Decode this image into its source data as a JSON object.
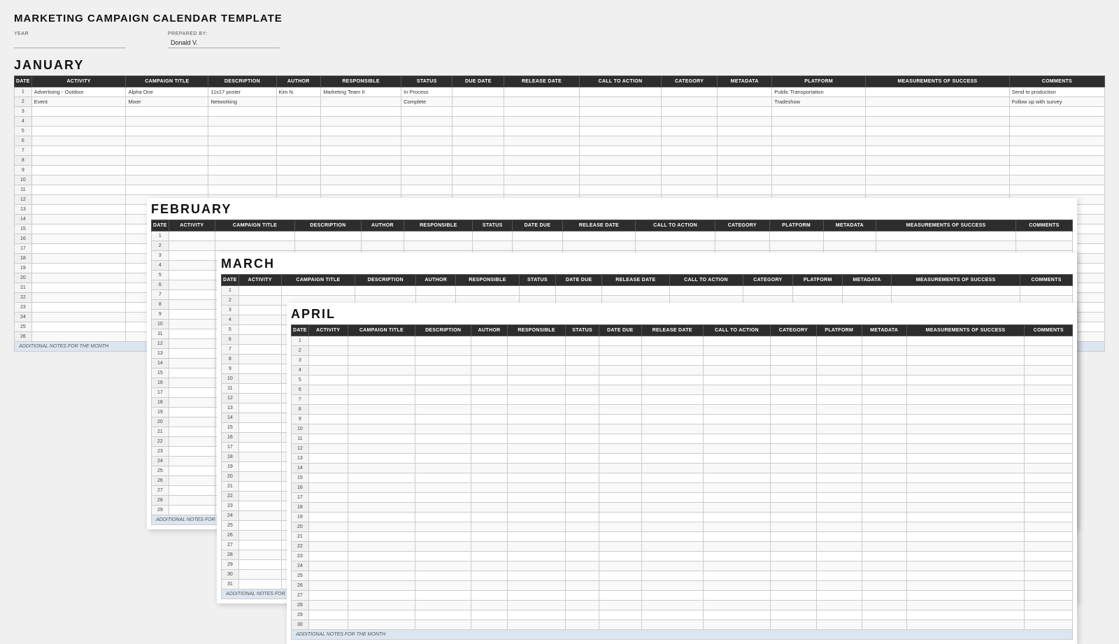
{
  "title": "MARKETING CAMPAIGN CALENDAR TEMPLATE",
  "fields": {
    "year_label": "YEAR",
    "year_value": "",
    "prepared_label": "PREPARED BY:",
    "prepared_value": "Donald V."
  },
  "months": {
    "january": {
      "name": "JANUARY",
      "columns": [
        "DATE",
        "ACTIVITY",
        "CAMPAIGN TITLE",
        "DESCRIPTION",
        "AUTHOR",
        "RESPONSIBLE",
        "STATUS",
        "DUE DATE",
        "RELEASE DATE",
        "CALL TO ACTION",
        "CATEGORY",
        "METADATA",
        "PLATFORM",
        "MEASUREMENTS OF SUCCESS",
        "COMMENTS"
      ],
      "rows": [
        {
          "date": "1",
          "activity": "Advertising - Outdoor",
          "campaign": "Alpha One",
          "description": "11x17 poster",
          "author": "Kim N.",
          "responsible": "Marketing Team II",
          "status": "In Process",
          "due": "",
          "release": "",
          "cta": "",
          "category": "",
          "metadata": "",
          "platform": "Public Transportation",
          "mos": "",
          "comments": "Send to production"
        },
        {
          "date": "2",
          "activity": "Event",
          "campaign": "Mixer",
          "description": "Networking",
          "author": "",
          "responsible": "",
          "status": "Complete",
          "due": "",
          "release": "",
          "cta": "",
          "category": "",
          "metadata": "",
          "platform": "Tradeshow",
          "mos": "",
          "comments": "Follow up with survey"
        },
        {
          "date": "3",
          "activity": "",
          "campaign": "",
          "description": "",
          "author": "",
          "responsible": "",
          "status": "",
          "due": "",
          "release": "",
          "cta": "",
          "category": "",
          "metadata": "",
          "platform": "",
          "mos": "",
          "comments": ""
        },
        {
          "date": "4",
          "activity": "",
          "campaign": "",
          "description": "",
          "author": "",
          "responsible": "",
          "status": "",
          "due": "",
          "release": "",
          "cta": "",
          "category": "",
          "metadata": "",
          "platform": "",
          "mos": "",
          "comments": ""
        },
        {
          "date": "5",
          "activity": "",
          "campaign": "",
          "description": "",
          "author": "",
          "responsible": "",
          "status": "",
          "due": "",
          "release": "",
          "cta": "",
          "category": "",
          "metadata": "",
          "platform": "",
          "mos": "",
          "comments": ""
        },
        {
          "date": "6",
          "activity": "",
          "campaign": "",
          "description": "",
          "author": "",
          "responsible": "",
          "status": "",
          "due": "",
          "release": "",
          "cta": "",
          "category": "",
          "metadata": "",
          "platform": "",
          "mos": "",
          "comments": ""
        },
        {
          "date": "7",
          "activity": "",
          "campaign": "",
          "description": "",
          "author": "",
          "responsible": "",
          "status": "",
          "due": "",
          "release": "",
          "cta": "",
          "category": "",
          "metadata": "",
          "platform": "",
          "mos": "",
          "comments": ""
        },
        {
          "date": "8",
          "activity": "",
          "campaign": "",
          "description": "",
          "author": "",
          "responsible": "",
          "status": "",
          "due": "",
          "release": "",
          "cta": "",
          "category": "",
          "metadata": "",
          "platform": "",
          "mos": "",
          "comments": ""
        },
        {
          "date": "9",
          "activity": "",
          "campaign": "",
          "description": "",
          "author": "",
          "responsible": "",
          "status": "",
          "due": "",
          "release": "",
          "cta": "",
          "category": "",
          "metadata": "",
          "platform": "",
          "mos": "",
          "comments": ""
        },
        {
          "date": "10",
          "activity": "",
          "campaign": "",
          "description": "",
          "author": "",
          "responsible": "",
          "status": "",
          "due": "",
          "release": "",
          "cta": "",
          "category": "",
          "metadata": "",
          "platform": "",
          "mos": "",
          "comments": ""
        },
        {
          "date": "11",
          "activity": "",
          "campaign": "",
          "description": "",
          "author": "",
          "responsible": "",
          "status": "",
          "due": "",
          "release": "",
          "cta": "",
          "category": "",
          "metadata": "",
          "platform": "",
          "mos": "",
          "comments": ""
        },
        {
          "date": "12",
          "activity": "",
          "campaign": "",
          "description": "",
          "author": "",
          "responsible": "",
          "status": "",
          "due": "",
          "release": "",
          "cta": "",
          "category": "",
          "metadata": "",
          "platform": "",
          "mos": "",
          "comments": ""
        },
        {
          "date": "13",
          "activity": "",
          "campaign": "",
          "description": "",
          "author": "",
          "responsible": "",
          "status": "",
          "due": "",
          "release": "",
          "cta": "",
          "category": "",
          "metadata": "",
          "platform": "",
          "mos": "",
          "comments": ""
        },
        {
          "date": "14",
          "activity": "",
          "campaign": "",
          "description": "",
          "author": "",
          "responsible": "",
          "status": "",
          "due": "",
          "release": "",
          "cta": "",
          "category": "",
          "metadata": "",
          "platform": "",
          "mos": "",
          "comments": ""
        },
        {
          "date": "15",
          "activity": "",
          "campaign": "",
          "description": "",
          "author": "",
          "responsible": "",
          "status": "",
          "due": "",
          "release": "",
          "cta": "",
          "category": "",
          "metadata": "",
          "platform": "",
          "mos": "",
          "comments": ""
        },
        {
          "date": "16",
          "activity": "",
          "campaign": "",
          "description": "",
          "author": "",
          "responsible": "",
          "status": "",
          "due": "",
          "release": "",
          "cta": "",
          "category": "",
          "metadata": "",
          "platform": "",
          "mos": "",
          "comments": ""
        },
        {
          "date": "17",
          "activity": "",
          "campaign": "",
          "description": "",
          "author": "",
          "responsible": "",
          "status": "",
          "due": "",
          "release": "",
          "cta": "",
          "category": "",
          "metadata": "",
          "platform": "",
          "mos": "",
          "comments": ""
        },
        {
          "date": "18",
          "activity": "",
          "campaign": "",
          "description": "",
          "author": "",
          "responsible": "",
          "status": "",
          "due": "",
          "release": "",
          "cta": "",
          "category": "",
          "metadata": "",
          "platform": "",
          "mos": "",
          "comments": ""
        },
        {
          "date": "19",
          "activity": "",
          "campaign": "",
          "description": "",
          "author": "",
          "responsible": "",
          "status": "",
          "due": "",
          "release": "",
          "cta": "",
          "category": "",
          "metadata": "",
          "platform": "",
          "mos": "",
          "comments": ""
        },
        {
          "date": "20",
          "activity": "",
          "campaign": "",
          "description": "",
          "author": "",
          "responsible": "",
          "status": "",
          "due": "",
          "release": "",
          "cta": "",
          "category": "",
          "metadata": "",
          "platform": "",
          "mos": "",
          "comments": ""
        },
        {
          "date": "21",
          "activity": "",
          "campaign": "",
          "description": "",
          "author": "",
          "responsible": "",
          "status": "",
          "due": "",
          "release": "",
          "cta": "",
          "category": "",
          "metadata": "",
          "platform": "",
          "mos": "",
          "comments": ""
        },
        {
          "date": "22",
          "activity": "",
          "campaign": "",
          "description": "",
          "author": "",
          "responsible": "",
          "status": "",
          "due": "",
          "release": "",
          "cta": "",
          "category": "",
          "metadata": "",
          "platform": "",
          "mos": "",
          "comments": ""
        },
        {
          "date": "23",
          "activity": "",
          "campaign": "",
          "description": "",
          "author": "",
          "responsible": "",
          "status": "",
          "due": "",
          "release": "",
          "cta": "",
          "category": "",
          "metadata": "",
          "platform": "",
          "mos": "",
          "comments": ""
        },
        {
          "date": "24",
          "activity": "",
          "campaign": "",
          "description": "",
          "author": "",
          "responsible": "",
          "status": "",
          "due": "",
          "release": "",
          "cta": "",
          "category": "",
          "metadata": "",
          "platform": "",
          "mos": "",
          "comments": ""
        },
        {
          "date": "25",
          "activity": "",
          "campaign": "",
          "description": "",
          "author": "",
          "responsible": "",
          "status": "",
          "due": "",
          "release": "",
          "cta": "",
          "category": "",
          "metadata": "",
          "platform": "",
          "mos": "",
          "comments": ""
        },
        {
          "date": "26",
          "activity": "",
          "campaign": "",
          "description": "",
          "author": "",
          "responsible": "",
          "status": "",
          "due": "",
          "release": "",
          "cta": "",
          "category": "",
          "metadata": "",
          "platform": "",
          "mos": "",
          "comments": ""
        }
      ],
      "notes": "ADDITIONAL NOTES FOR THE MONTH"
    },
    "february": {
      "name": "FEBRUARY",
      "columns": [
        "DATE",
        "ACTIVITY",
        "CAMPAIGN TITLE",
        "DESCRIPTION",
        "AUTHOR",
        "RESPONSIBLE",
        "STATUS",
        "DATE DUE",
        "RELEASE DATE",
        "CALL TO ACTION",
        "CATEGORY",
        "PLATFORM",
        "METADATA",
        "MEASUREMENTS OF SUCCESS",
        "COMMENTS"
      ],
      "row_count": 29,
      "notes": "ADDITIONAL NOTES FOR"
    },
    "march": {
      "name": "MARCH",
      "columns": [
        "DATE",
        "ACTIVITY",
        "CAMPAIGN TITLE",
        "DESCRIPTION",
        "AUTHOR",
        "RESPONSIBLE",
        "STATUS",
        "DATE DUE",
        "RELEASE DATE",
        "CALL TO ACTION",
        "CATEGORY",
        "PLATFORM",
        "METADATA",
        "MEASUREMENTS OF SUCCESS",
        "COMMENTS"
      ],
      "row_count": 31,
      "notes": "ADDITIONAL NOTES FOR"
    },
    "april": {
      "name": "APRIL",
      "columns": [
        "DATE",
        "ACTIVITY",
        "CAMPAIGN TITLE",
        "DESCRIPTION",
        "AUTHOR",
        "RESPONSIBLE",
        "STATUS",
        "DATE DUE",
        "RELEASE DATE",
        "CALL TO ACTION",
        "CATEGORY",
        "PLATFORM",
        "METADATA",
        "MEASUREMENTS OF SUCCESS",
        "COMMENTS"
      ],
      "row_count": 30,
      "notes": "ADDITIONAL NOTES FOR THE MONTH"
    }
  }
}
